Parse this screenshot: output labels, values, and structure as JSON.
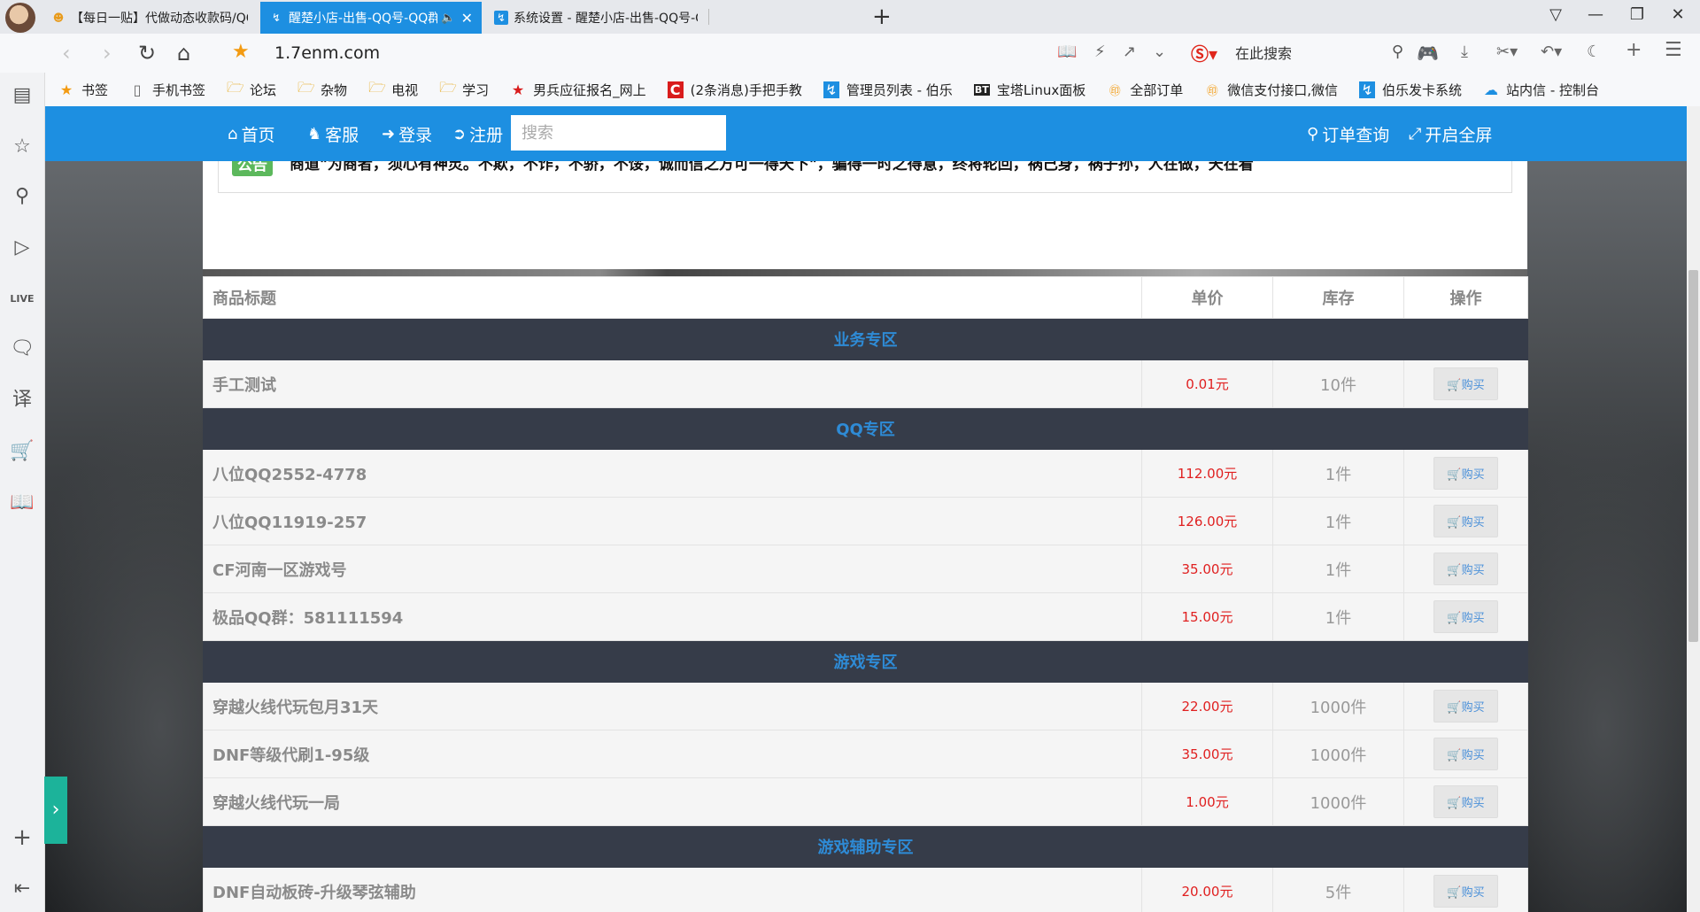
{
  "tabs": [
    {
      "title": "【每日一贴】代做动态收款码/QQ/Q",
      "active": false
    },
    {
      "title": "醒楚小店-出售-QQ号-QQ群-游戏",
      "active": true
    },
    {
      "title": "系统设置 - 醒楚小店-出售-QQ号-QQ",
      "active": false
    }
  ],
  "address": {
    "url": "1.7enm.com",
    "search_text": "在此搜索"
  },
  "bookmarks": [
    {
      "icon": "star-icon",
      "label": "书签"
    },
    {
      "icon": "phone-icon",
      "label": "手机书签"
    },
    {
      "icon": "folder-icon",
      "label": "论坛"
    },
    {
      "icon": "folder-icon",
      "label": "杂物"
    },
    {
      "icon": "folder-icon",
      "label": "电视"
    },
    {
      "icon": "folder-icon",
      "label": "学习"
    },
    {
      "icon": "red-star-icon",
      "label": "男兵应征报名_网上"
    },
    {
      "icon": "c-logo-icon",
      "label": "(2条消息)手把手教"
    },
    {
      "icon": "blue-page-icon",
      "label": "管理员列表 - 伯乐"
    },
    {
      "icon": "bt-icon",
      "label": "宝塔Linux面板"
    },
    {
      "icon": "code-icon",
      "label": "全部订单"
    },
    {
      "icon": "code-icon",
      "label": "微信支付接口,微信"
    },
    {
      "icon": "blue-page-icon",
      "label": "伯乐发卡系统"
    },
    {
      "icon": "cloud-icon",
      "label": "站内信 - 控制台"
    }
  ],
  "nav": {
    "home": "首页",
    "service": "客服",
    "login": "登录",
    "register": "注册",
    "search_placeholder": "搜索",
    "order_query": "订单查询",
    "fullscreen": "开启全屏"
  },
  "notice": {
    "label": "公告",
    "text": "商道\"为商者，须心有神灵。不欺，不诈，不骄，不馁，诚而信之方可一得天下\"，骗得一时之得意，终将轮回，祸己身，祸子孙，人在做，天在看"
  },
  "table": {
    "headers": {
      "title": "商品标题",
      "price": "单价",
      "stock": "库存",
      "action": "操作"
    },
    "buy_label": "购买",
    "sections": [
      {
        "name": "业务专区",
        "items": [
          {
            "name": "手工测试",
            "price": "0.01元",
            "stock": "10件"
          }
        ]
      },
      {
        "name": "QQ专区",
        "items": [
          {
            "name": "八位QQ2552-4778",
            "price": "112.00元",
            "stock": "1件"
          },
          {
            "name": "八位QQ11919-257",
            "price": "126.00元",
            "stock": "1件"
          },
          {
            "name": "CF河南一区游戏号",
            "price": "35.00元",
            "stock": "1件"
          },
          {
            "name": "极品QQ群：581111594",
            "price": "15.00元",
            "stock": "1件"
          }
        ]
      },
      {
        "name": "游戏专区",
        "items": [
          {
            "name": "穿越火线代玩包月31天",
            "price": "22.00元",
            "stock": "1000件"
          },
          {
            "name": "DNF等级代刷1-95级",
            "price": "35.00元",
            "stock": "1000件"
          },
          {
            "name": "穿越火线代玩一局",
            "price": "1.00元",
            "stock": "1000件"
          }
        ]
      },
      {
        "name": "游戏辅助专区",
        "items": [
          {
            "name": "DNF自动板砖-升级琴弦辅助",
            "price": "20.00元",
            "stock": "5件"
          }
        ]
      }
    ]
  },
  "colors": {
    "accent": "#1d8fe1",
    "category_bg": "#363c49",
    "price": "#e02020",
    "notice_label": "#5cb85c"
  }
}
